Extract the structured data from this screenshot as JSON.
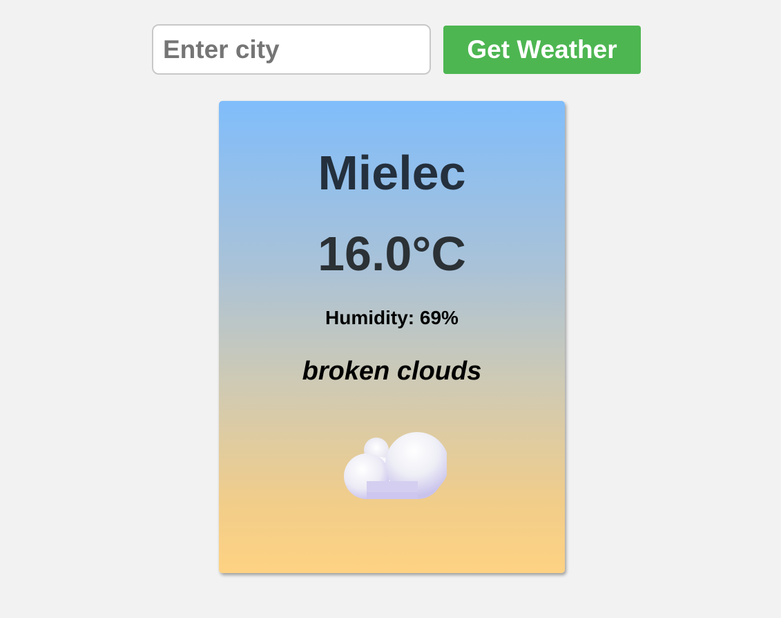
{
  "search": {
    "placeholder": "Enter city",
    "value": "",
    "button_label": "Get Weather"
  },
  "weather": {
    "city": "Mielec",
    "temperature": "16.0°C",
    "humidity": "Humidity: 69%",
    "description": "broken clouds",
    "icon": "cloud-icon"
  },
  "colors": {
    "background": "#f2f2f2",
    "button": "#4db651",
    "card_gradient_top": "#80bdfb",
    "card_gradient_bottom": "#fed283"
  }
}
